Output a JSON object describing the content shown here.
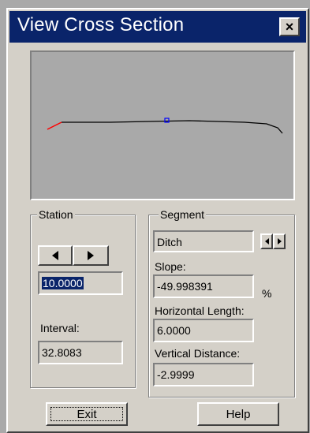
{
  "window": {
    "title": "View Cross Section",
    "close_glyph": "×"
  },
  "station": {
    "group_label": "Station",
    "value": "10.0000",
    "interval_label": "Interval:",
    "interval_value": "32.8083",
    "prev_icon": "triangle-left-icon",
    "next_icon": "triangle-right-icon"
  },
  "segment": {
    "group_label": "Segment",
    "name": "Ditch",
    "slope_label": "Slope:",
    "slope_value": "-49.998391",
    "slope_unit": "%",
    "hlength_label": "Horizontal Length:",
    "hlength_value": "6.0000",
    "vdist_label": "Vertical Distance:",
    "vdist_value": "-2.9999"
  },
  "buttons": {
    "exit": "Exit",
    "help": "Help"
  },
  "colors": {
    "profile_line": "#000000",
    "highlighted_segment": "#ff0000",
    "station_marker": "#0000ff"
  }
}
